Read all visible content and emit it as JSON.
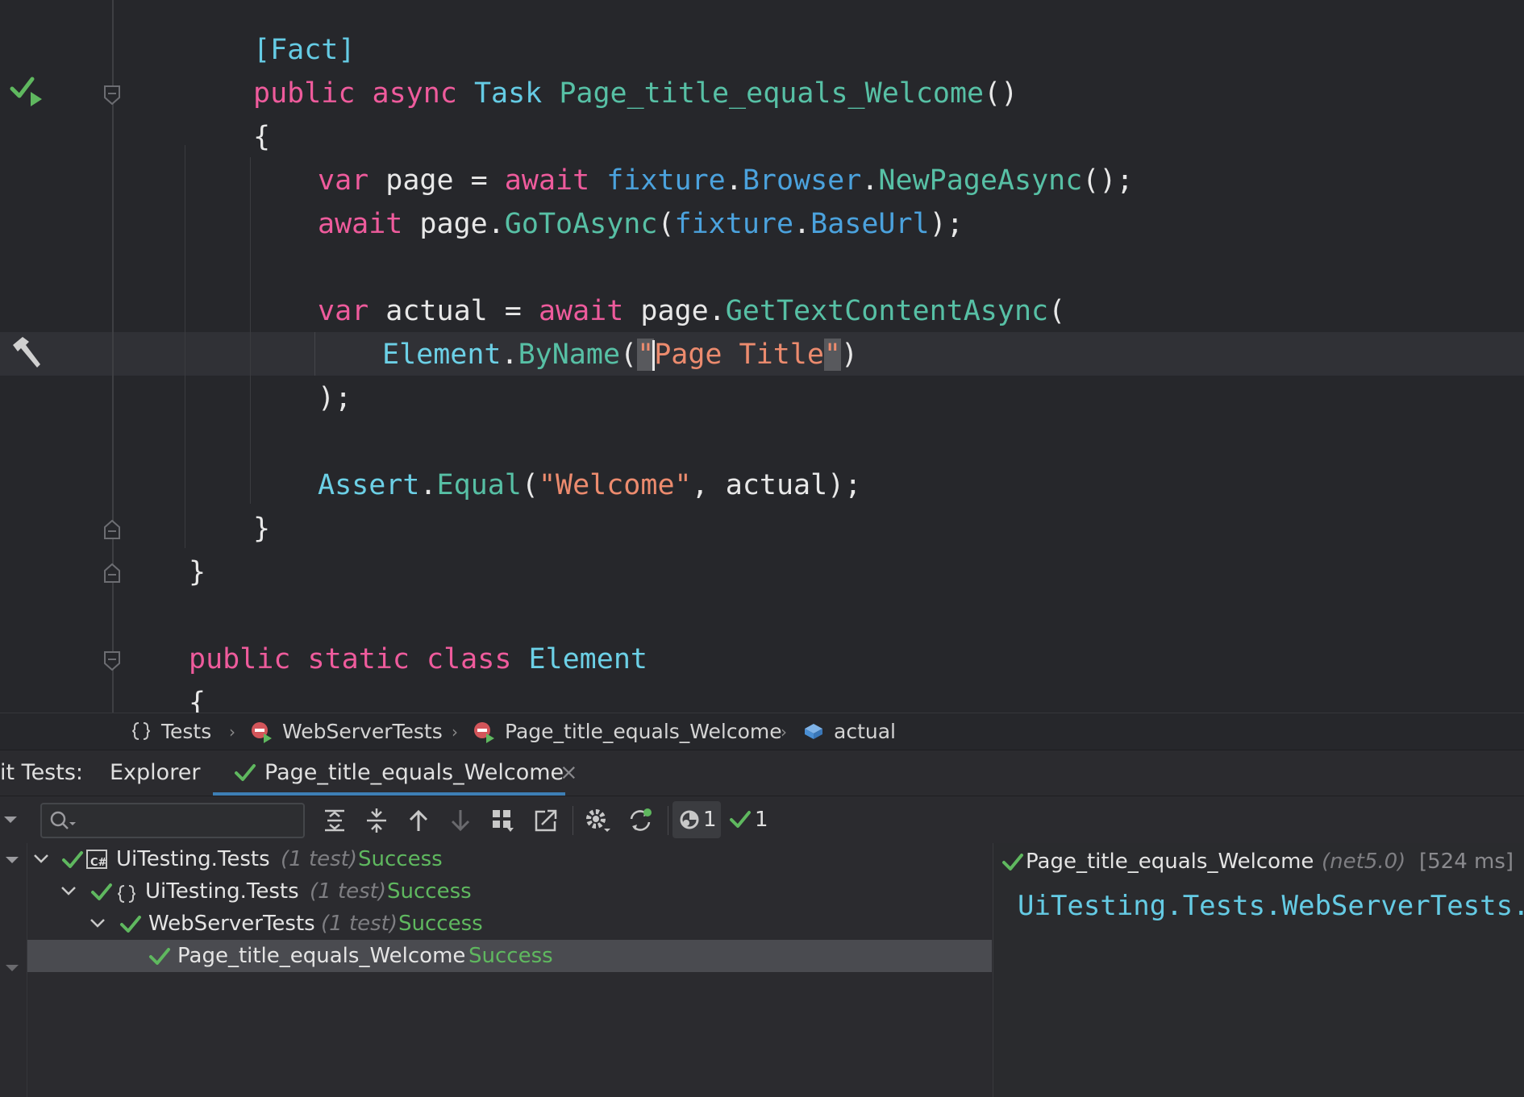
{
  "editor": {
    "lines": {
      "l1_attr": "[Fact]",
      "l2_kw1": "public",
      "l2_kw2": "async",
      "l2_type": "Task",
      "l2_name": "Page_title_equals_Welcome",
      "l2_tail": "()",
      "l3": "{",
      "l4_kw": "var",
      "l4_a": " page = ",
      "l4_await": "await",
      "l4_f": "fixture",
      "l4_dot1": ".",
      "l4_b": "Browser",
      "l4_dot2": ".",
      "l4_m": "NewPageAsync",
      "l4_tail": "();",
      "l5_await": "await",
      "l5_a": " page.",
      "l5_m": "GoToAsync",
      "l5_p": "(",
      "l5_f": "fixture",
      "l5_dot": ".",
      "l5_b": "BaseUrl",
      "l5_tail": ");",
      "l7_kw": "var",
      "l7_a": " actual = ",
      "l7_await": "await",
      "l7_b": " page.",
      "l7_m": "GetTextContentAsync",
      "l7_tail": "(",
      "l8_cls": "Element",
      "l8_dot": ".",
      "l8_m": "ByName",
      "l8_p": "(",
      "l8_q1": "\"",
      "l8_str": "Page Title",
      "l8_q2": "\"",
      "l8_tail": ")",
      "l9": ");",
      "l11_cls": "Assert",
      "l11_dot": ".",
      "l11_m": "Equal",
      "l11_p": "(",
      "l11_str": "\"Welcome\"",
      "l11_tail": ", actual);",
      "l12": "}",
      "l13": "}",
      "l15_kw1": "public",
      "l15_kw2": "static",
      "l15_kw3": "class",
      "l15_name": "Element",
      "l16": "{"
    }
  },
  "breadcrumb": {
    "items": [
      "Tests",
      "WebServerTests",
      "Page_title_equals_Welcome",
      "actual"
    ],
    "sep": "›"
  },
  "tool_window": {
    "prefix": "it Tests:",
    "tab_explorer": "Explorer",
    "tab_session": "Page_title_equals_Welcome",
    "close_glyph": "×",
    "search_placeholder": "",
    "count_running": "1",
    "count_passed": "1"
  },
  "tree": {
    "rows": [
      {
        "name": "UiTesting.Tests",
        "meta": "(1 test)",
        "status": "Success"
      },
      {
        "name": "UiTesting.Tests",
        "meta": "(1 test)",
        "status": "Success"
      },
      {
        "name": "WebServerTests",
        "meta": "(1 test)",
        "status": "Success"
      },
      {
        "name": "Page_title_equals_Welcome",
        "meta": "",
        "status": "Success"
      }
    ]
  },
  "detail": {
    "title": "Page_title_equals_Welcome",
    "framework": "(net5.0)",
    "duration": "[524 ms]",
    "output": "UiTesting.Tests.WebServerTests.P"
  },
  "colors": {
    "keyword": "#ee5b9c",
    "type": "#65cbe4",
    "method": "#57c0a5",
    "member": "#4ba2dd",
    "string": "#ec8b6e",
    "success": "#5fb85f",
    "accent": "#3d7fb5"
  },
  "icons": [
    "run-passed-icon",
    "hammer-icon",
    "namespace-icon",
    "class-error-icon",
    "method-error-icon",
    "variable-icon",
    "check-icon",
    "search-icon",
    "expand-all-icon",
    "collapse-all-icon",
    "arrow-up-icon",
    "arrow-down-icon",
    "group-icon",
    "export-icon",
    "settings-icon",
    "refresh-icon",
    "running-tests-icon",
    "csharp-project-icon"
  ]
}
